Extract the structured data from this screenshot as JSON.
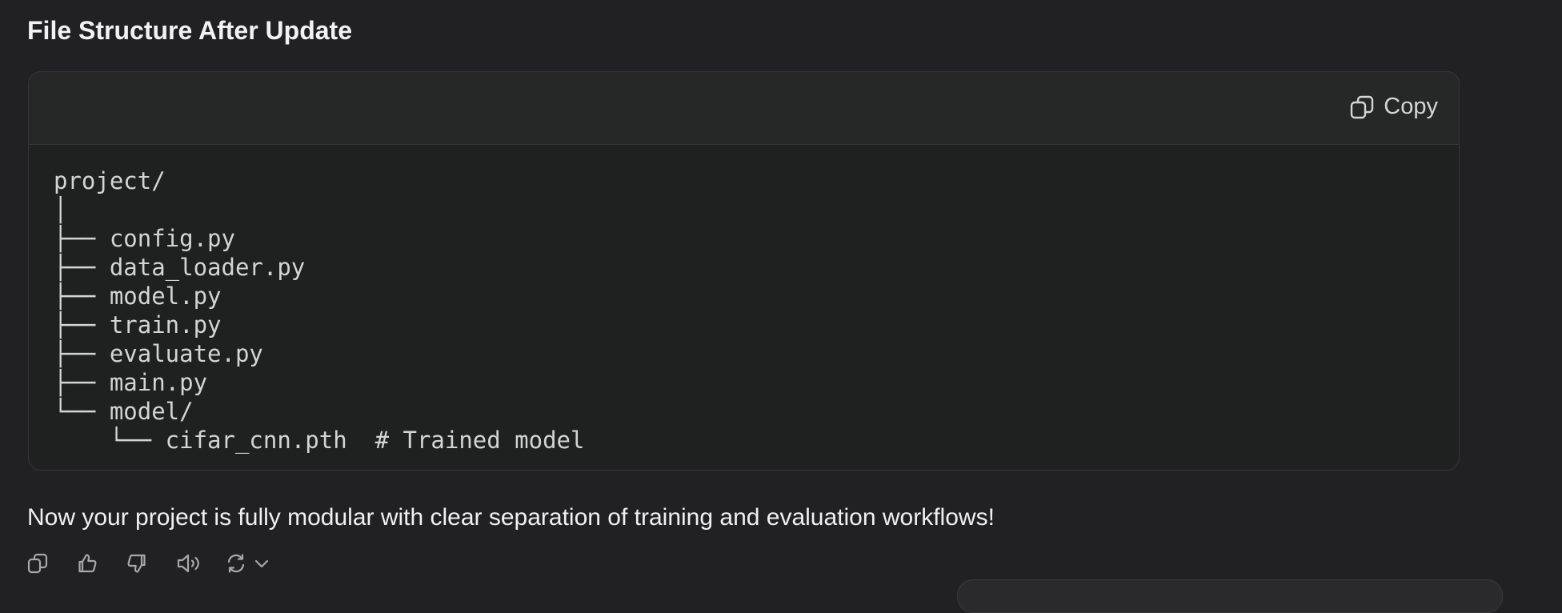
{
  "heading": "File Structure After Update",
  "code_block": {
    "copy_label": "Copy",
    "lines": [
      "project/",
      "│",
      "├── config.py",
      "├── data_loader.py",
      "├── model.py",
      "├── train.py",
      "├── evaluate.py",
      "├── main.py",
      "└── model/",
      "    └── cifar_cnn.pth  # Trained model"
    ]
  },
  "summary": "Now your project is fully modular with clear separation of training and evaluation workflows!",
  "actions": {
    "icons": [
      "copy-icon",
      "thumbs-up-icon",
      "thumbs-down-icon",
      "speaker-icon",
      "regenerate-icon",
      "chevron-down-icon"
    ]
  },
  "colors": {
    "background": "#212124",
    "code_header": "#262727",
    "code_body": "#1f2020",
    "border": "#36363a"
  }
}
